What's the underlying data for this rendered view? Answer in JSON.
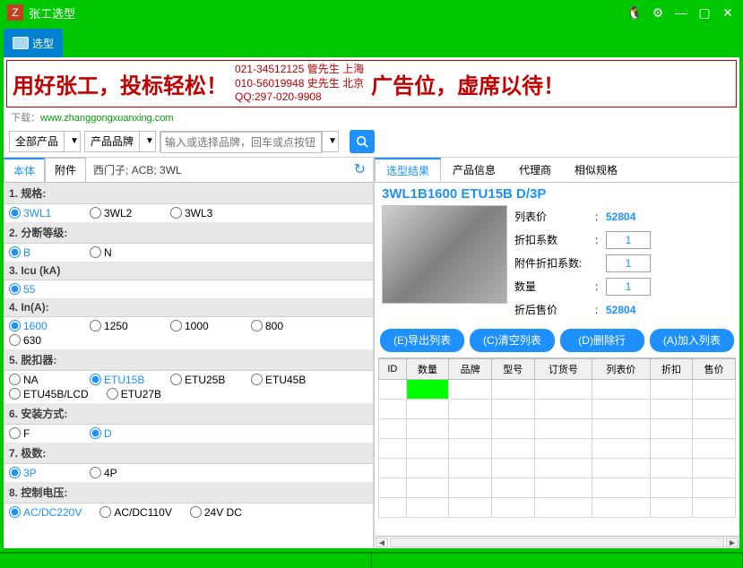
{
  "window": {
    "title": "张工选型"
  },
  "tab": {
    "label": "选型"
  },
  "banner": {
    "left": "用好张工，投标轻松！",
    "mid1": "021-34512125  管先生  上海",
    "mid2": "010-56019948  史先生  北京",
    "mid3": "QQ:297-020-9908",
    "right": "广告位，虚席以待！",
    "download_label": "下载：",
    "download_url": "www.zhanggongxuanxing.com"
  },
  "toolbar": {
    "allprod": "全部产品",
    "brandlabel": "产品品牌",
    "brand_placeholder": "输入或选择品牌，回车或点按钮"
  },
  "subtabs": {
    "t1": "本体",
    "t2": "附件",
    "crumb": "西门子; ACB; 3WL"
  },
  "specs": [
    {
      "title": "1. 规格:",
      "opts": [
        "3WL1",
        "3WL2",
        "3WL3"
      ],
      "sel": "3WL1"
    },
    {
      "title": "2. 分断等级:",
      "opts": [
        "B",
        "N"
      ],
      "sel": "B"
    },
    {
      "title": "3. Icu (kA)",
      "opts": [
        "55"
      ],
      "sel": "55"
    },
    {
      "title": "4. In(A):",
      "opts": [
        "1600",
        "1250",
        "1000",
        "800",
        "630"
      ],
      "sel": "1600"
    },
    {
      "title": "5. 脱扣器:",
      "opts": [
        "NA",
        "ETU15B",
        "ETU25B",
        "ETU45B",
        "ETU45B/LCD",
        "ETU27B"
      ],
      "sel": "ETU15B"
    },
    {
      "title": "6. 安装方式:",
      "opts": [
        "F",
        "D"
      ],
      "sel": "D"
    },
    {
      "title": "7. 极数:",
      "opts": [
        "3P",
        "4P"
      ],
      "sel": "3P"
    },
    {
      "title": "8. 控制电压:",
      "opts": [
        "AC/DC220V",
        "AC/DC110V",
        "24V DC"
      ],
      "sel": "AC/DC220V"
    }
  ],
  "rtabs": {
    "t1": "选型结果",
    "t2": "产品信息",
    "t3": "代理商",
    "t4": "相似规格"
  },
  "product": {
    "title": "3WL1B1600 ETU15B D/3P",
    "list_price_label": "列表价",
    "list_price": "52804",
    "discount_label": "折扣系数",
    "discount": "1",
    "acc_discount_label": "附件折扣系数:",
    "acc_discount": "1",
    "qty_label": "数量",
    "qty": "1",
    "after_label": "折后售价",
    "after": "52804"
  },
  "buttons": {
    "b1": "(E)导出列表",
    "b2": "(C)清空列表",
    "b3": "(D)删除行",
    "b4": "(A)加入列表"
  },
  "grid_headers": [
    "ID",
    "数量",
    "品牌",
    "型号",
    "订货号",
    "列表价",
    "折扣",
    "售价"
  ]
}
